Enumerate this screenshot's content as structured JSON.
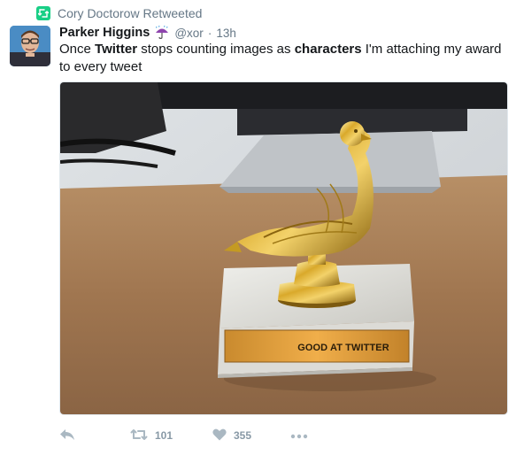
{
  "context": {
    "label": "Cory Doctorow Retweeted",
    "icon": "retweet-icon",
    "accent": "#19cf86"
  },
  "author": {
    "name": "Parker Higgins",
    "emoji_icon": "umbrella-rain-icon",
    "handle": "@xor",
    "separator": "·",
    "time": "13h"
  },
  "tweet": {
    "segments": [
      {
        "text": "Once ",
        "bold": false
      },
      {
        "text": "Twitter",
        "bold": true
      },
      {
        "text": " stops counting images as ",
        "bold": false
      },
      {
        "text": "characters",
        "bold": true
      },
      {
        "text": " I'm attaching my award to every tweet",
        "bold": false
      }
    ]
  },
  "media": {
    "plaque_text": "GOOD AT TWITTER"
  },
  "actions": {
    "reply_icon": "reply-icon",
    "retweet_icon": "retweet-icon",
    "retweet_count": "101",
    "like_icon": "heart-icon",
    "like_count": "355",
    "more_icon": "more-dots-icon"
  }
}
